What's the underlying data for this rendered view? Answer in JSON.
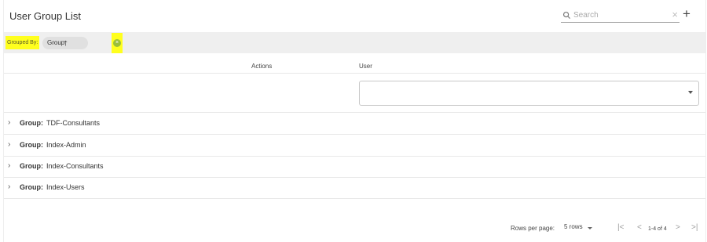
{
  "header": {
    "title": "User Group List"
  },
  "search": {
    "placeholder": "Search",
    "value": "",
    "clear_glyph": "×"
  },
  "toolbar": {
    "add_glyph": "+"
  },
  "grouping": {
    "label": "Grouped By:",
    "chip_label": "Group",
    "chip_arrow": "🡑",
    "remove_glyph": "×"
  },
  "columns": {
    "actions": "Actions",
    "user": "User"
  },
  "filter": {
    "user_value": ""
  },
  "groups": [
    {
      "key": "Group:",
      "value": "TDF-Consultants"
    },
    {
      "key": "Group:",
      "value": "Index-Admin"
    },
    {
      "key": "Group:",
      "value": "Index-Consultants"
    },
    {
      "key": "Group:",
      "value": "Index-Users"
    }
  ],
  "pagination": {
    "rows_per_page_label": "Rows per page:",
    "rows_per_page_value": "5 rows",
    "range_text": "1-4 of 4",
    "first_glyph": "|<",
    "prev_glyph": "<",
    "next_glyph": ">",
    "last_glyph": ">|"
  },
  "colors": {
    "highlight": "#ffff1e",
    "chip_remove": "#9bbf3a",
    "group_bar": "#efefef"
  },
  "icons": {
    "search": "search-icon",
    "expand": "chevron-right-icon",
    "dropdown": "chevron-down-icon"
  }
}
